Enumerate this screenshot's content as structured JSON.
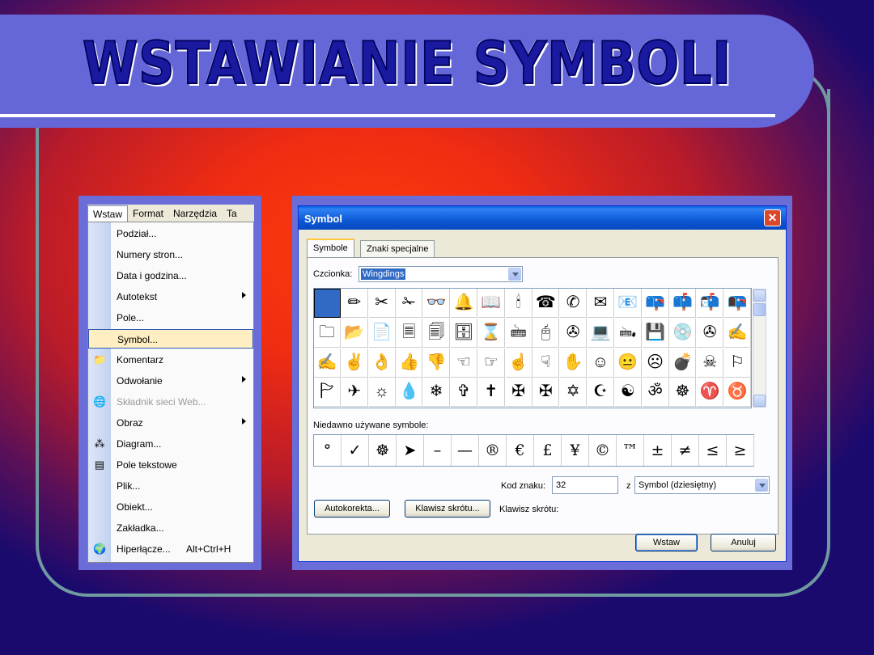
{
  "slide": {
    "title": "WSTAWIANIE SYMBOLI",
    "colors": {
      "title_bar": "#6566d8",
      "title_text": "#1a1aa0",
      "frame": "#6f9aa0",
      "bg_center": "#ff3c0a",
      "bg_edge": "#1a0a6e"
    }
  },
  "menu": {
    "menubar": [
      "Wstaw",
      "Format",
      "Narzędzia",
      "Ta"
    ],
    "active_menu": "Wstaw",
    "items": [
      {
        "label": "Podział...",
        "icon": ""
      },
      {
        "label": "Numery stron...",
        "icon": ""
      },
      {
        "label": "Data i godzina...",
        "icon": ""
      },
      {
        "label": "Autotekst",
        "icon": "",
        "submenu": true
      },
      {
        "label": "Pole...",
        "icon": ""
      },
      {
        "label": "Symbol...",
        "icon": "",
        "highlighted": true
      },
      {
        "label": "Komentarz",
        "icon": "folder-comment-icon"
      },
      {
        "label": "Odwołanie",
        "icon": "",
        "submenu": true
      },
      {
        "label": "Składnik sieci Web...",
        "icon": "web-component-icon",
        "disabled": true
      },
      {
        "label": "Obraz",
        "icon": "",
        "submenu": true
      },
      {
        "label": "Diagram...",
        "icon": "diagram-icon"
      },
      {
        "label": "Pole tekstowe",
        "icon": "textbox-icon"
      },
      {
        "label": "Plik...",
        "icon": ""
      },
      {
        "label": "Obiekt...",
        "icon": ""
      },
      {
        "label": "Zakładka...",
        "icon": ""
      },
      {
        "label": "Hiperłącze...",
        "icon": "hyperlink-icon",
        "shortcut": "Alt+Ctrl+H"
      }
    ]
  },
  "dialog": {
    "title": "Symbol",
    "close": "✕",
    "tabs": [
      "Symbole",
      "Znaki specjalne"
    ],
    "font_label": "Czcionka:",
    "font_value": "Wingdings",
    "symbols": [
      [
        " ",
        "✏",
        "✂",
        "✁",
        "👓",
        "🔔",
        "📖",
        "🕯",
        "☎",
        "✆",
        "✉",
        "📧",
        "📪",
        "📫",
        "📬",
        "📭"
      ],
      [
        "🗀",
        "📂",
        "📄",
        "🗏",
        "🗐",
        "🗄",
        "⌛",
        "🖮",
        "🖰",
        "✇",
        "💻",
        "🖦",
        "💾",
        "💿",
        "✇",
        "✍"
      ],
      [
        "✍",
        "✌",
        "👌",
        "👍",
        "👎",
        "☜",
        "☞",
        "☝",
        "☟",
        "✋",
        "☺",
        "😐",
        "☹",
        "💣",
        "☠",
        "⚐"
      ],
      [
        "🏱",
        "✈",
        "☼",
        "💧",
        "❄",
        "✞",
        "✝",
        "✠",
        "✠",
        "✡",
        "☪",
        "☯",
        "ॐ",
        "☸",
        "♈",
        "♉"
      ]
    ],
    "recent_label": "Niedawno używane symbole:",
    "recent": [
      "°",
      "✓",
      "☸",
      "➤",
      "–",
      "—",
      "®",
      "€",
      "£",
      "¥",
      "©",
      "™",
      "±",
      "≠",
      "≤",
      "≥"
    ],
    "code_label": "Kod znaku:",
    "code_value": "32",
    "from_label": "z",
    "from_value": "Symbol (dziesiętny)",
    "autocorrect_button": "Autokorekta...",
    "shortcut_button": "Klawisz skrótu...",
    "shortcut_label": "Klawisz skrótu:",
    "insert_button": "Wstaw",
    "cancel_button": "Anuluj"
  }
}
